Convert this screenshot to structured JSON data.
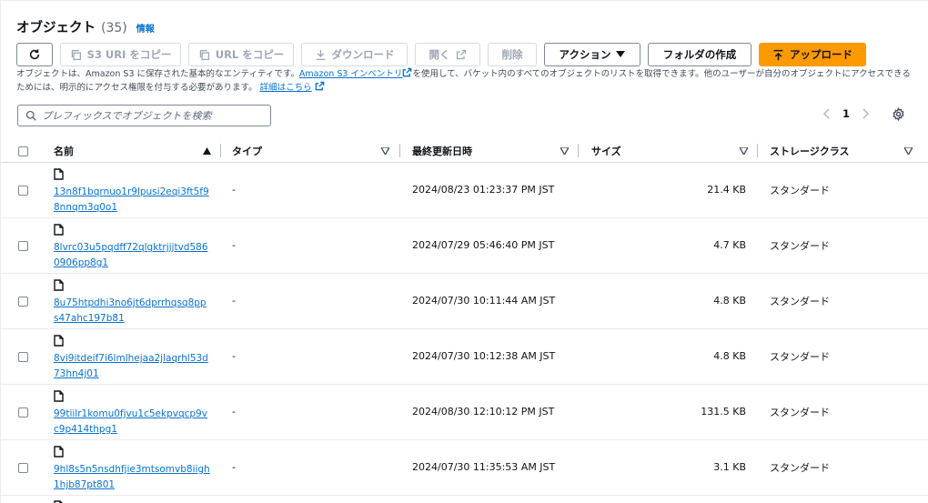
{
  "header": {
    "title": "オブジェクト",
    "count": "(35)",
    "info_link": "情報"
  },
  "toolbar": {
    "refresh_icon": "refresh-icon",
    "copy_s3_uri": "S3 URI をコピー",
    "copy_url": "URL をコピー",
    "download": "ダウンロード",
    "open": "開く",
    "delete": "削除",
    "actions": "アクション",
    "create_folder": "フォルダの作成",
    "upload": "アップロード"
  },
  "description": {
    "part1": "オブジェクトは、Amazon S3 に保存された基本的なエンティティです。",
    "inventory_link": "Amazon S3 インベントリ",
    "part2": "を使用して、バケット内のすべてのオブジェクトのリストを取得できます。他のユーザーが自分のオブジェクトにアクセスできるためには、明示的にアクセス権限を付与する必要があります。",
    "details_link": "詳細はこちら"
  },
  "search": {
    "placeholder": "プレフィックスでオブジェクトを検索",
    "value": ""
  },
  "pagination": {
    "current_page": "1"
  },
  "table": {
    "columns": {
      "name": "名前",
      "type": "タイプ",
      "last_modified": "最終更新日時",
      "size": "サイズ",
      "storage_class": "ストレージクラス"
    },
    "rows": [
      {
        "name": "13n8f1bqrnuo1r9lpusi2eqi3ft5f98nnqm3q0o1",
        "type": "-",
        "last_modified": "2024/08/23 01:23:37 PM JST",
        "size": "21.4 KB",
        "storage_class": "スタンダード"
      },
      {
        "name": "8lvrc03u5pqdff72qlgktrjjjtvd5860906pp8g1",
        "type": "-",
        "last_modified": "2024/07/29 05:46:40 PM JST",
        "size": "4.7 KB",
        "storage_class": "スタンダード"
      },
      {
        "name": "8u75htpdhi3no6jt6dprrhqsq8pps47ahc197b81",
        "type": "-",
        "last_modified": "2024/07/30 10:11:44 AM JST",
        "size": "4.8 KB",
        "storage_class": "スタンダード"
      },
      {
        "name": "8vi9itdeif7i6lmlhejaa2jlaqrhl53d73hn4j01",
        "type": "-",
        "last_modified": "2024/07/30 10:12:38 AM JST",
        "size": "4.8 KB",
        "storage_class": "スタンダード"
      },
      {
        "name": "99tiilr1komu0fjvu1c5ekpvqcp9vc9p414thpg1",
        "type": "-",
        "last_modified": "2024/08/30 12:10:12 PM JST",
        "size": "131.5 KB",
        "storage_class": "スタンダード"
      },
      {
        "name": "9hl8s5n5nsdhfjie3mtsomvb8iigh1hjb87pt801",
        "type": "-",
        "last_modified": "2024/07/30 11:35:53 AM JST",
        "size": "3.1 KB",
        "storage_class": "スタンダード"
      }
    ]
  },
  "colors": {
    "link": "#0972d3",
    "primary": "#ff9900",
    "border": "#7d8998",
    "text": "#0f141a"
  }
}
